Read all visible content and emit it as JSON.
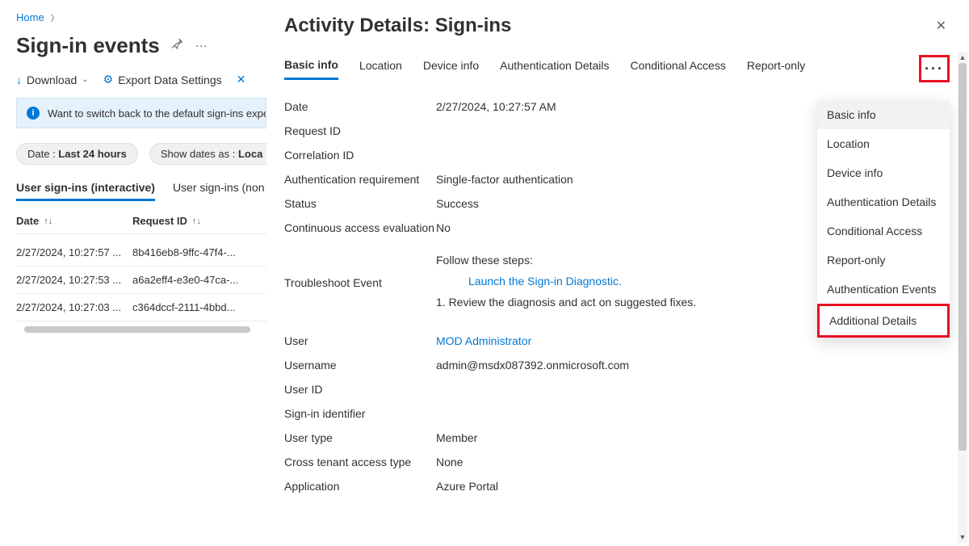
{
  "breadcrumb": {
    "home": "Home"
  },
  "pageTitle": "Sign-in events",
  "toolbar": {
    "download": "Download",
    "export": "Export Data Settings"
  },
  "banner": {
    "text": "Want to switch back to the default sign-ins experi"
  },
  "filters": {
    "dateLabel": "Date : ",
    "dateValue": "Last 24 hours",
    "showAsLabel": "Show dates as : ",
    "showAsValue": "Loca"
  },
  "listTabs": {
    "interactive": "User sign-ins (interactive)",
    "noninteractive": "User sign-ins (non"
  },
  "columns": {
    "date": "Date",
    "requestId": "Request ID"
  },
  "rows": [
    {
      "date": "2/27/2024, 10:27:57 ...",
      "req": "8b416eb8-9ffc-47f4-..."
    },
    {
      "date": "2/27/2024, 10:27:53 ...",
      "req": "a6a2eff4-e3e0-47ca-..."
    },
    {
      "date": "2/27/2024, 10:27:03 ...",
      "req": "c364dccf-2111-4bbd..."
    }
  ],
  "panel": {
    "title": "Activity Details: Sign-ins",
    "tabs": [
      "Basic info",
      "Location",
      "Device info",
      "Authentication Details",
      "Conditional Access",
      "Report-only"
    ],
    "fields": {
      "date": {
        "label": "Date",
        "value": "2/27/2024, 10:27:57 AM"
      },
      "requestId": {
        "label": "Request ID",
        "value": ""
      },
      "correlationId": {
        "label": "Correlation ID",
        "value": ""
      },
      "authReq": {
        "label": "Authentication requirement",
        "value": "Single-factor authentication"
      },
      "status": {
        "label": "Status",
        "value": "Success"
      },
      "cae": {
        "label": "Continuous access evaluation",
        "value": "No"
      },
      "troubleshoot": {
        "label": "Troubleshoot Event",
        "follow": "Follow these steps:",
        "link": "Launch the Sign-in Diagnostic.",
        "step1": "1. Review the diagnosis and act on suggested fixes."
      },
      "user": {
        "label": "User",
        "value": "MOD Administrator"
      },
      "username": {
        "label": "Username",
        "value": "admin@msdx087392.onmicrosoft.com"
      },
      "userId": {
        "label": "User ID",
        "value": ""
      },
      "signinId": {
        "label": "Sign-in identifier",
        "value": ""
      },
      "userType": {
        "label": "User type",
        "value": "Member"
      },
      "crossTenant": {
        "label": "Cross tenant access type",
        "value": "None"
      },
      "application": {
        "label": "Application",
        "value": "Azure Portal"
      }
    },
    "dropdown": [
      "Basic info",
      "Location",
      "Device info",
      "Authentication Details",
      "Conditional Access",
      "Report-only",
      "Authentication Events",
      "Additional Details"
    ]
  }
}
